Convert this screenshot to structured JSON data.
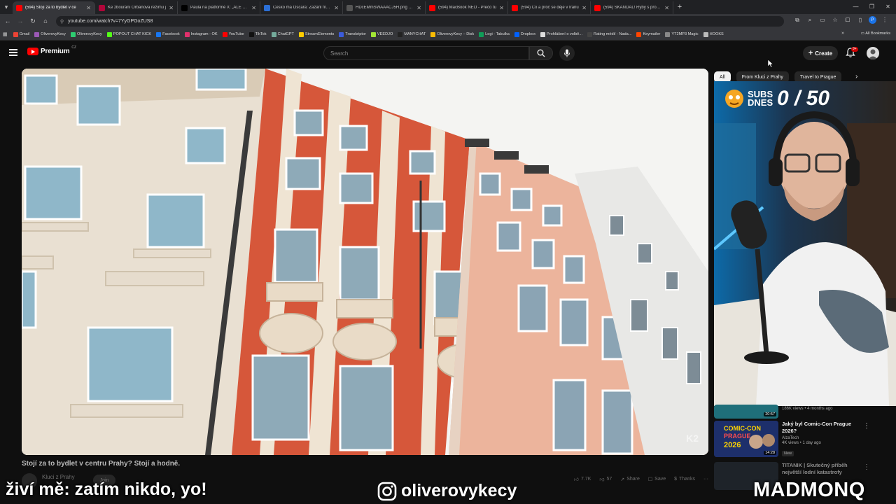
{
  "browser": {
    "tabs": [
      {
        "title": "(594) Stojí za to bydlet v ce",
        "color": "#ff0000",
        "active": true
      },
      {
        "title": "Ke zbourání Orbánova režimu j",
        "color": "#b0063a",
        "active": false
      },
      {
        "title": "Paula na platformě X: „ALE PAV",
        "color": "#000000",
        "active": false
      },
      {
        "title": "Česko má Oscara: Zazářil film o",
        "color": "#2b6fd6",
        "active": false
      },
      {
        "title": "HDcEMmSWAAACJ5H.png (10",
        "color": "#555555",
        "active": false
      },
      {
        "title": "(594) MacBook NEO - Prečo tu",
        "color": "#ff0000",
        "active": false
      },
      {
        "title": "(594) Co a proč se děje v Íránu",
        "color": "#ff0000",
        "active": false
      },
      {
        "title": "(594) SKANDÁL! Ryby s pročíje",
        "color": "#ff0000",
        "active": false
      }
    ],
    "url": "youtube.com/watch?v=7YyGPGoZUS8",
    "profile_initial": "P",
    "bookmarks": [
      {
        "label": "Gmail",
        "color": "#ea4335"
      },
      {
        "label": "OliverovyKecy",
        "color": "#9b59b6"
      },
      {
        "label": "OliverovyKecy",
        "color": "#2ecc71"
      },
      {
        "label": "POPOUT CHAT KICK",
        "color": "#53fc18"
      },
      {
        "label": "Facebook",
        "color": "#1877f2"
      },
      {
        "label": "Instagram - OK",
        "color": "#e1306c"
      },
      {
        "label": "YouTube",
        "color": "#ff0000"
      },
      {
        "label": "TikTok",
        "color": "#111111"
      },
      {
        "label": "ChatGPT",
        "color": "#74aa9c"
      },
      {
        "label": "StreamElements",
        "color": "#ffcc00"
      },
      {
        "label": "Transkriptor",
        "color": "#3b5bdb"
      },
      {
        "label": "VEEDJO",
        "color": "#a3e635"
      },
      {
        "label": "MANYCHAT",
        "color": "#222222"
      },
      {
        "label": "OliverovyKecy – Disk",
        "color": "#fbbc04"
      },
      {
        "label": "Logi - Tabulka",
        "color": "#0f9d58"
      },
      {
        "label": "Dropbox",
        "color": "#0061ff"
      },
      {
        "label": "Prohlášení o volbě...",
        "color": "#dddddd"
      },
      {
        "label": "Rating médií - Nada...",
        "color": "#444444"
      },
      {
        "label": "Keymailer",
        "color": "#ff4500"
      },
      {
        "label": "YT2MP3 Magic",
        "color": "#888888"
      },
      {
        "label": "HOOKS",
        "color": "#bbbbbb"
      }
    ],
    "all_bookmarks": "All Bookmarks"
  },
  "youtube": {
    "logo": "Premium",
    "country": "CZ",
    "search_placeholder": "Search",
    "create": "Create",
    "notifications": "9+",
    "video": {
      "watermark": "K2",
      "title": "Stojí za to bydlet v centru Prahy? Stojí a hodně.",
      "channel": "Kluci z Prahy",
      "join": "Join",
      "likes": "7.7K",
      "dislikes": "57",
      "share": "Share",
      "save": "Save",
      "thanks": "Thanks"
    },
    "chips": [
      "All",
      "From Kluci z Prahy",
      "Travel to Prague"
    ],
    "recommendations": [
      {
        "title": "",
        "channel": "",
        "views": "186K views • 4 months ago",
        "duration": "20:57",
        "new": "",
        "thumb": "#1f6f7a"
      },
      {
        "title": "Jaký byl Comic-Con Prague 2026?",
        "channel": "AlzaTech",
        "views": "4K views • 1 day ago",
        "duration": "14:28",
        "new": "New",
        "thumb": "#233a7a"
      },
      {
        "title": "TITANIK | Skutečný příběh největší lodní katastrofy",
        "channel": "",
        "views": "",
        "duration": "",
        "new": "",
        "thumb": "#2b3440"
      }
    ]
  },
  "stream": {
    "subs_label": "SUBS DNES",
    "subs_count": "0 / 50",
    "overlay_left": "živí mě: zatím nikdo, yo!",
    "instagram": "oliverovykecy",
    "brand": "MADMONQ"
  }
}
